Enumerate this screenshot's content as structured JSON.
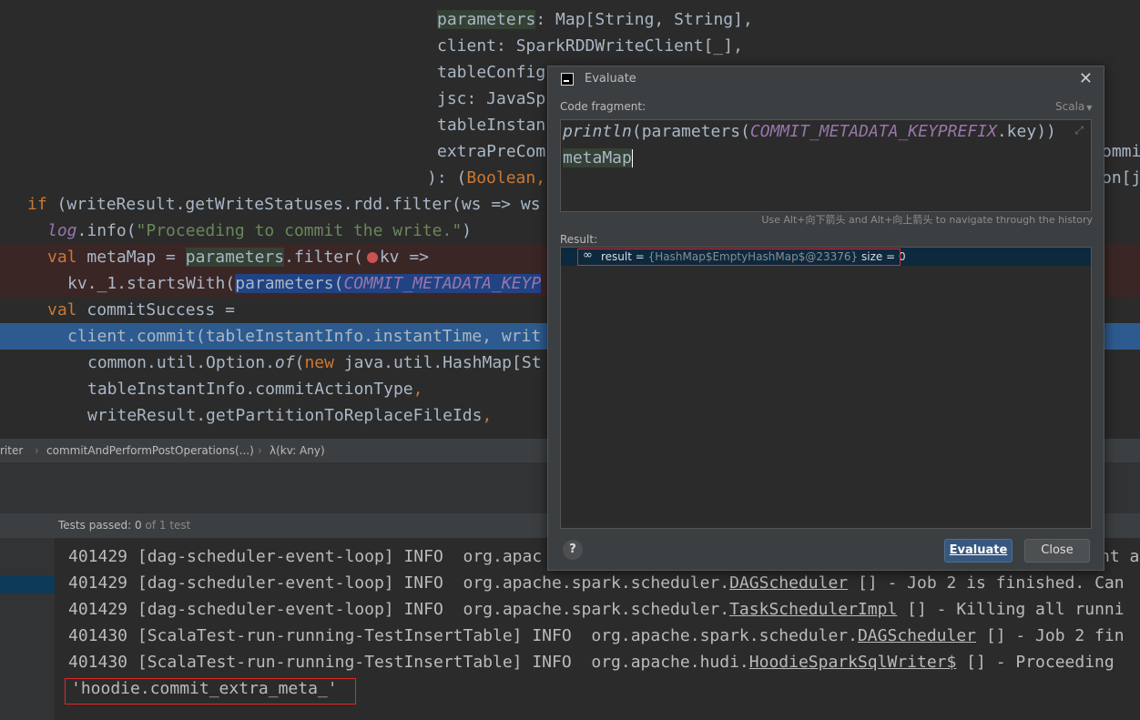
{
  "editor": {
    "lines": {
      "l1a": "parameters",
      "l1b": ": Map[String, String],",
      "l2": "client: SparkRDDWriteClient[_],",
      "l3": "tableConfig",
      "l4": "jsc: JavaSp",
      "l5": "tableInstan",
      "l6": "extraPreCom",
      "l6r": "ommit",
      "l7a": "): (",
      "l7b": "Boolean,",
      "l7r": "on[ja",
      "l8a": "if",
      "l8b": " (writeResult.getWriteStatuses.rdd.filter(ws => ws",
      "l9a": "log",
      "l9b": ".info(",
      "l9c": "\"Proceeding to commit the write.\"",
      "l9d": ")",
      "l10a": "val",
      "l10b": " metaMap = ",
      "l10c": "parameters",
      "l10d": ".filter(",
      "l10e": "kv =>",
      "l11a": "kv._1.startsWith(",
      "l11b": "parameters(",
      "l11c": "COMMIT_METADATA_KEYP",
      "l12a": "val",
      "l12b": " commitSuccess =",
      "l13a": "client.commit(tableInstantInfo.instantTime,",
      "l13b": " writ",
      "l14a": "common.util.Option.",
      "l14b": "of",
      "l14c": "(",
      "l14d": "new",
      "l14e": " java.util.HashMap[St",
      "l15a": "tableInstantInfo.commitActionType",
      "l15b": ",",
      "l16a": "writeResult.getPartitionToReplaceFileIds",
      "l16b": ","
    }
  },
  "breadcrumb": {
    "items": [
      "riter",
      "commitAndPerformPostOperations(...)",
      "λ(kv: Any)"
    ]
  },
  "tests": {
    "passed_label": "Tests passed:",
    "passed": "0",
    "of": "of 1 test"
  },
  "console": {
    "lines": [
      {
        "ts": "401429",
        "rest": " [dag-scheduler-event-loop] INFO  org.apac",
        "tail": "nt a"
      },
      {
        "ts": "401429",
        "rest": " [dag-scheduler-event-loop] INFO  org.apache.spark.scheduler.",
        "cls": "DAGScheduler",
        "tail": " [] - Job 2 is finished. Can"
      },
      {
        "ts": "401429",
        "rest": " [dag-scheduler-event-loop] INFO  org.apache.spark.scheduler.",
        "cls": "TaskSchedulerImpl",
        "tail": " [] - Killing all runni"
      },
      {
        "ts": "401430",
        "rest": " [ScalaTest-run-running-TestInsertTable] INFO  org.apache.spark.scheduler.",
        "cls": "DAGScheduler",
        "tail": " [] - Job 2 fin"
      },
      {
        "ts": "401430",
        "rest": " [ScalaTest-run-running-TestInsertTable] INFO  org.apache.hudi.",
        "cls": "HoodieSparkSqlWriter$",
        "tail": " [] - Proceeding"
      }
    ],
    "output": "'hoodie.commit_extra_meta_'"
  },
  "dialog": {
    "title": "Evaluate",
    "code_fragment_label": "Code fragment:",
    "language": "Scala",
    "code": {
      "l1a": "println",
      "l1b": "(parameters(",
      "l1c": "COMMIT_METADATA_KEYPREFIX",
      "l1d": ".key))",
      "l2": "metaMap"
    },
    "history_hint": "Use Alt+向下箭头 and Alt+向上箭头 to navigate through the history",
    "result_label": "Result:",
    "result": {
      "name": "result",
      "eq": " = ",
      "value": "{HashMap$EmptyHashMap$@23376}",
      "size": " size = 0"
    },
    "help": "?",
    "evaluate_button": "Evaluate",
    "close_button": "Close"
  },
  "colors": {
    "keyword": "#cc7832",
    "string": "#6a8759",
    "constant": "#9876aa",
    "highlight_box": "#e3262b",
    "selection": "#2d5b8f"
  }
}
